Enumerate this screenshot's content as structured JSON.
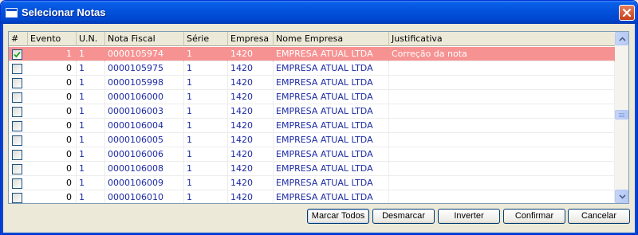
{
  "window": {
    "title": "Selecionar Notas"
  },
  "grid": {
    "columns": [
      "#",
      "Evento",
      "U.N.",
      "Nota Fiscal",
      "Série",
      "Empresa",
      "Nome Empresa",
      "Justificativa"
    ],
    "rows": [
      {
        "checked": true,
        "evento": "1",
        "un": "1",
        "nota": "0000105974",
        "serie": "1",
        "empresa": "1420",
        "nome": "EMPRESA ATUAL LTDA",
        "justificativa": "Correção da nota",
        "selected": true
      },
      {
        "checked": false,
        "evento": "0",
        "un": "1",
        "nota": "0000105975",
        "serie": "1",
        "empresa": "1420",
        "nome": "EMPRESA ATUAL LTDA",
        "justificativa": ""
      },
      {
        "checked": false,
        "evento": "0",
        "un": "1",
        "nota": "0000105998",
        "serie": "1",
        "empresa": "1420",
        "nome": "EMPRESA ATUAL LTDA",
        "justificativa": ""
      },
      {
        "checked": false,
        "evento": "0",
        "un": "1",
        "nota": "0000106000",
        "serie": "1",
        "empresa": "1420",
        "nome": "EMPRESA ATUAL LTDA",
        "justificativa": ""
      },
      {
        "checked": false,
        "evento": "0",
        "un": "1",
        "nota": "0000106003",
        "serie": "1",
        "empresa": "1420",
        "nome": "EMPRESA ATUAL LTDA",
        "justificativa": ""
      },
      {
        "checked": false,
        "evento": "0",
        "un": "1",
        "nota": "0000106004",
        "serie": "1",
        "empresa": "1420",
        "nome": "EMPRESA ATUAL LTDA",
        "justificativa": ""
      },
      {
        "checked": false,
        "evento": "0",
        "un": "1",
        "nota": "0000106005",
        "serie": "1",
        "empresa": "1420",
        "nome": "EMPRESA ATUAL LTDA",
        "justificativa": ""
      },
      {
        "checked": false,
        "evento": "0",
        "un": "1",
        "nota": "0000106006",
        "serie": "1",
        "empresa": "1420",
        "nome": "EMPRESA ATUAL LTDA",
        "justificativa": ""
      },
      {
        "checked": false,
        "evento": "0",
        "un": "1",
        "nota": "0000106008",
        "serie": "1",
        "empresa": "1420",
        "nome": "EMPRESA ATUAL LTDA",
        "justificativa": ""
      },
      {
        "checked": false,
        "evento": "0",
        "un": "1",
        "nota": "0000106009",
        "serie": "1",
        "empresa": "1420",
        "nome": "EMPRESA ATUAL LTDA",
        "justificativa": ""
      },
      {
        "checked": false,
        "evento": "0",
        "un": "1",
        "nota": "0000106010",
        "serie": "1",
        "empresa": "1420",
        "nome": "EMPRESA ATUAL LTDA",
        "justificativa": ""
      }
    ]
  },
  "buttons": {
    "marcar_todos": "Marcar Todos",
    "desmarcar": "Desmarcar",
    "inverter": "Inverter",
    "confirmar": "Confirmar",
    "cancelar": "Cancelar"
  },
  "colors": {
    "selected_row": "#f79292",
    "text_blue": "#1c2aa5",
    "titlebar": "#0047d0"
  },
  "icons": {
    "title": "window-icon",
    "close": "close-icon",
    "check": "checkmark-icon",
    "scroll_up": "chevron-up-icon",
    "scroll_down": "chevron-down-icon"
  }
}
